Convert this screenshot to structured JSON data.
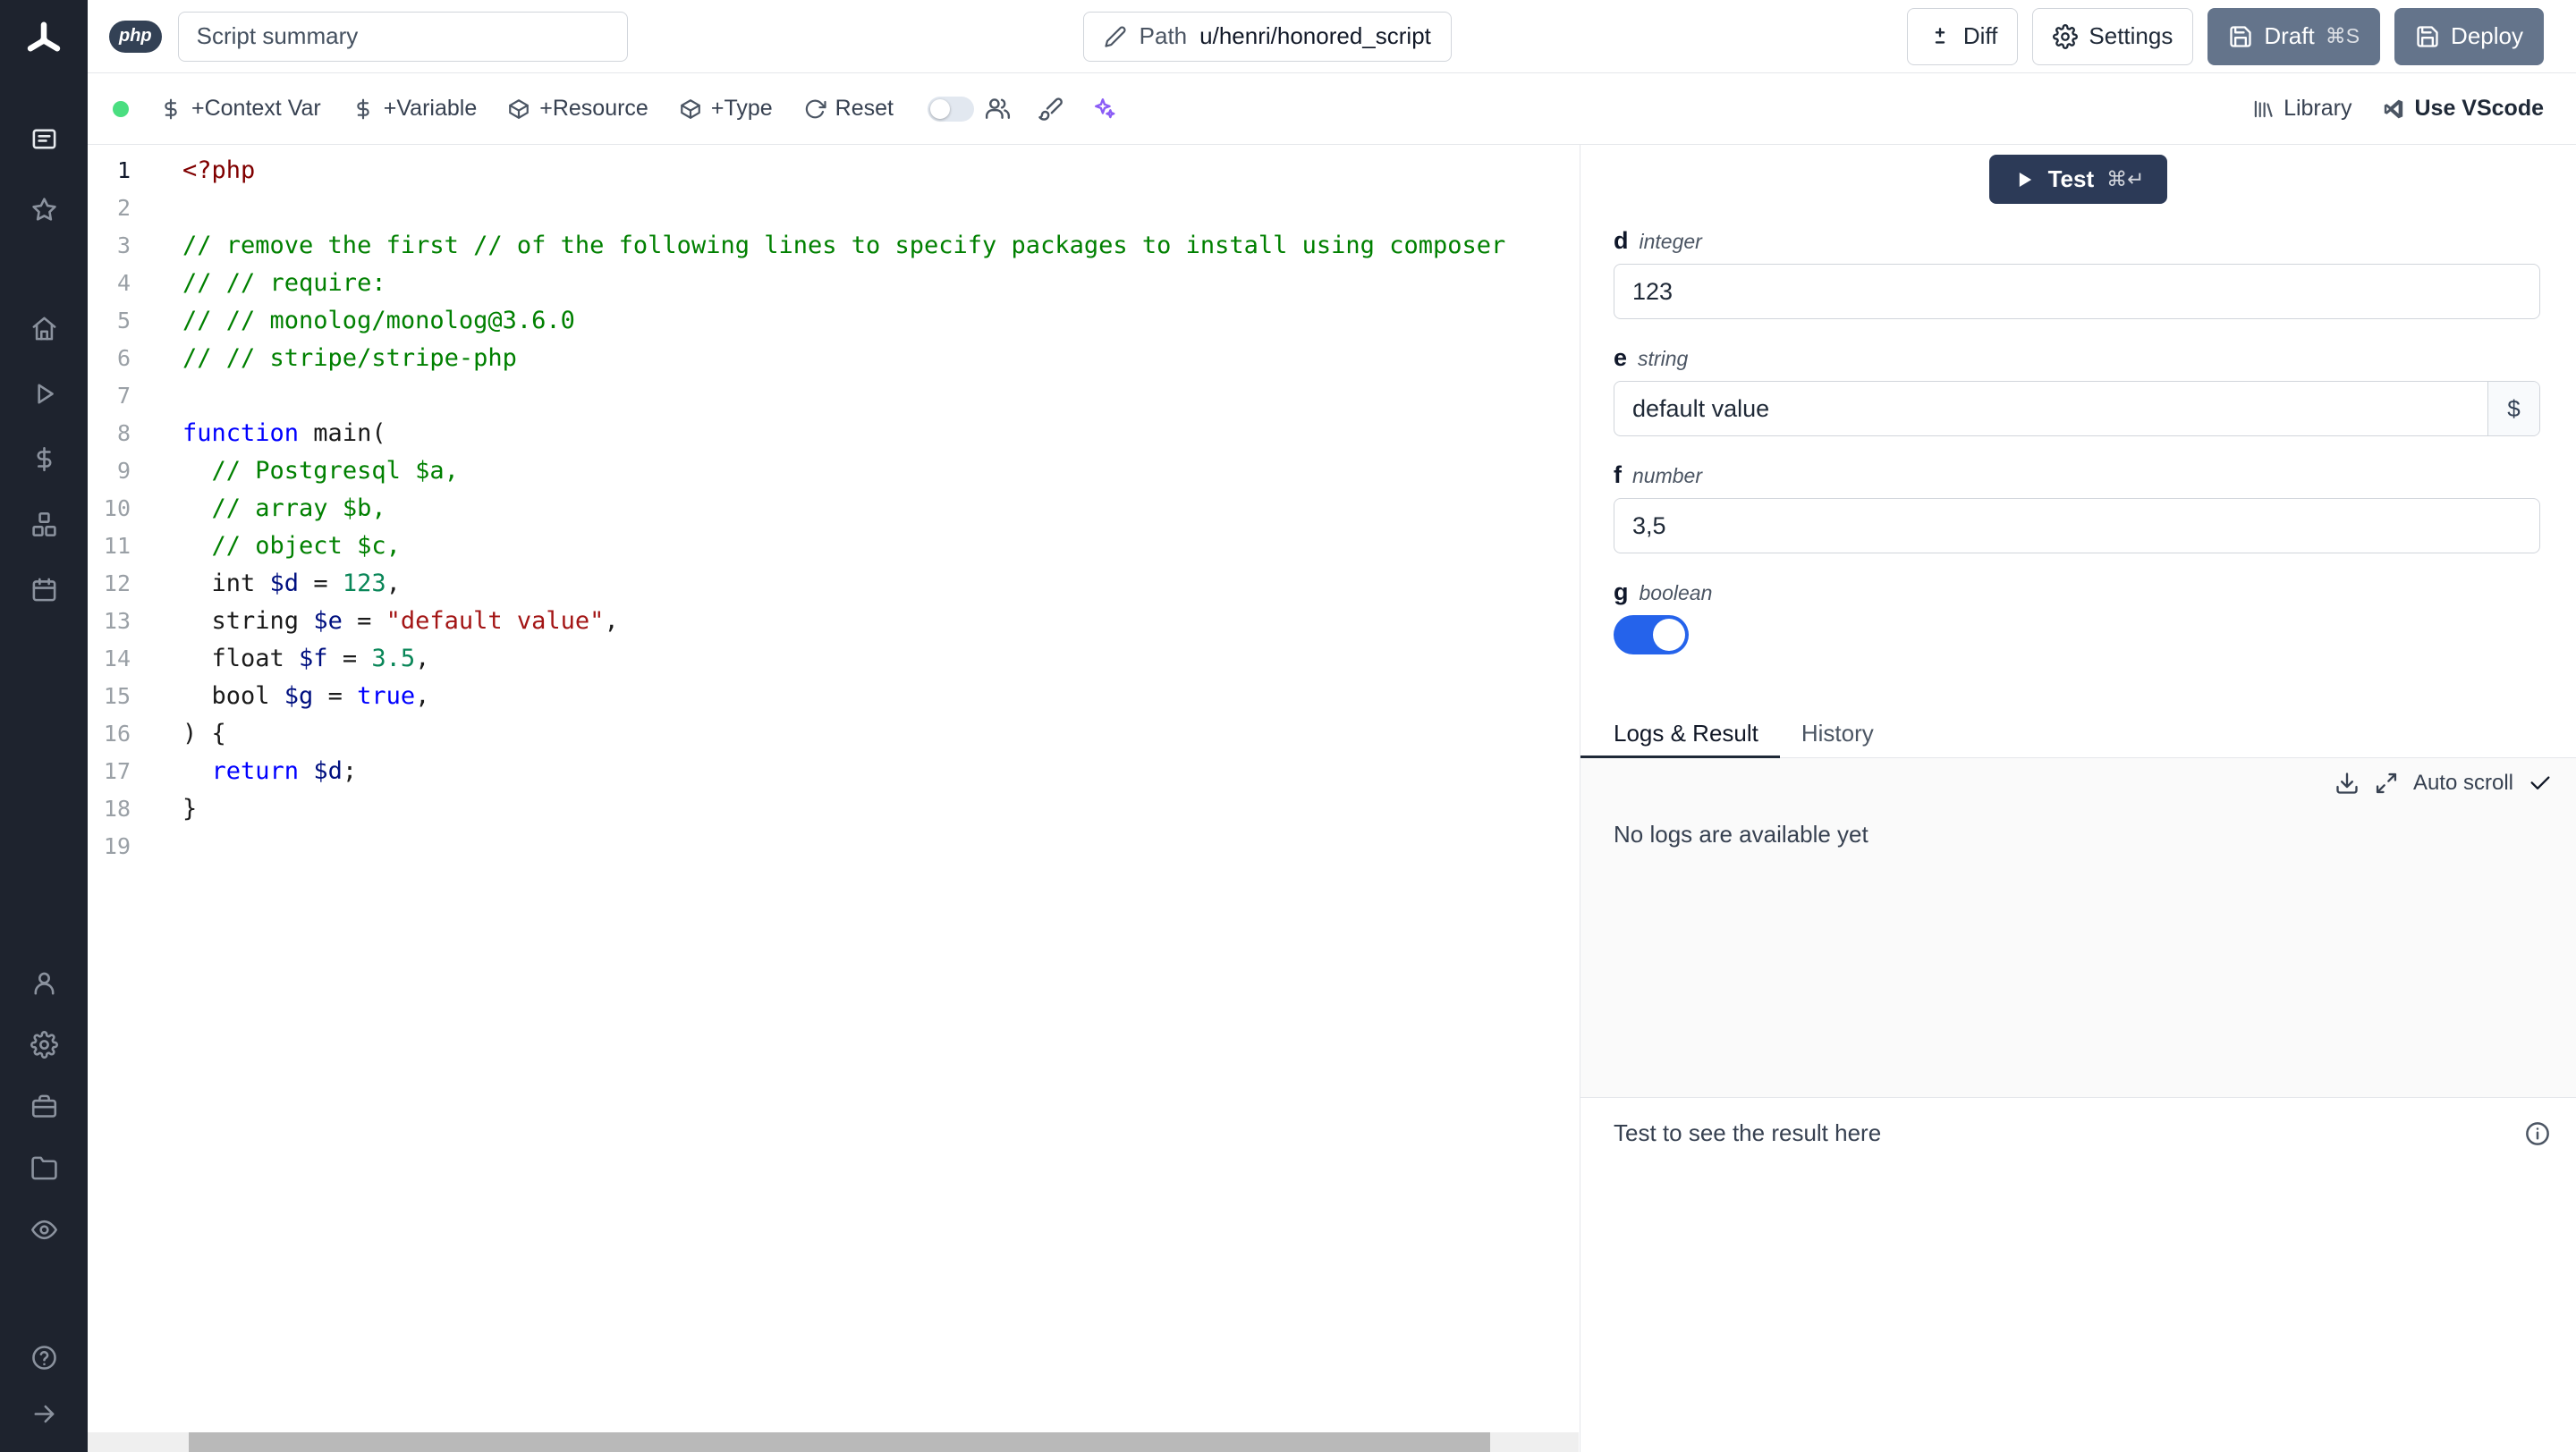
{
  "colors": {
    "accent_blue": "#2563eb",
    "sidebar_bg": "#1e232e",
    "slate_button_bg": "#64748b",
    "test_button_bg": "#2c3a57",
    "sparkle_purple": "#8b5cf6",
    "status_green": "#4ade80",
    "tab_active_underline": "#1f2937"
  },
  "topbar": {
    "language_badge": "php",
    "summary_placeholder": "Script summary",
    "path": {
      "label": "Path",
      "value": "u/henri/honored_script"
    },
    "buttons": {
      "diff": "Diff",
      "settings": "Settings",
      "draft": "Draft",
      "draft_shortcut": "⌘S",
      "deploy": "Deploy"
    }
  },
  "toolbar": {
    "left_items": [
      {
        "icon": "dollar-icon",
        "label": "+Context Var",
        "name": "add-context-var"
      },
      {
        "icon": "dollar-icon",
        "label": "+Variable",
        "name": "add-variable"
      },
      {
        "icon": "package-icon",
        "label": "+Resource",
        "name": "add-resource"
      },
      {
        "icon": "package-icon",
        "label": "+Type",
        "name": "add-type"
      },
      {
        "icon": "reset-icon",
        "label": "Reset",
        "name": "reset"
      }
    ],
    "library_label": "Library",
    "vscode_label": "Use VScode"
  },
  "sidebar": {
    "groups": [
      {
        "items": [
          {
            "icon": "panel-icon",
            "name": "quick-menu",
            "active": true
          },
          {
            "icon": "star-icon",
            "name": "favorites"
          }
        ]
      },
      {
        "items": [
          {
            "icon": "home-icon",
            "name": "home"
          },
          {
            "icon": "play-icon",
            "name": "runs"
          },
          {
            "icon": "dollar-icon",
            "name": "variables"
          },
          {
            "icon": "boxes-icon",
            "name": "resources"
          },
          {
            "icon": "calendar-icon",
            "name": "schedules"
          }
        ]
      },
      {
        "items": [
          {
            "icon": "user-icon",
            "name": "account"
          },
          {
            "icon": "gear-icon",
            "name": "settings"
          },
          {
            "icon": "toolbox-icon",
            "name": "workers"
          },
          {
            "icon": "folder-icon",
            "name": "folders"
          },
          {
            "icon": "eye-icon",
            "name": "audit-logs"
          }
        ]
      },
      {
        "items": [
          {
            "icon": "help-icon",
            "name": "help"
          },
          {
            "icon": "arrow-right-icon",
            "name": "expand-sidebar"
          }
        ]
      }
    ]
  },
  "editor": {
    "active_line": 1,
    "lines": [
      [
        {
          "t": "<?php",
          "c": "tag"
        }
      ],
      [],
      [
        {
          "t": "// remove the first // of the following lines to specify packages to install using composer",
          "c": "com"
        }
      ],
      [
        {
          "t": "// // require:",
          "c": "com"
        }
      ],
      [
        {
          "t": "// // monolog/monolog@3.6.0",
          "c": "com"
        }
      ],
      [
        {
          "t": "// // stripe/stripe-php",
          "c": "com"
        }
      ],
      [],
      [
        {
          "t": "function",
          "c": "kw"
        },
        {
          "t": " main(",
          "c": "pl"
        }
      ],
      [
        {
          "t": "  ",
          "c": "pl"
        },
        {
          "t": "// Postgresql $a,",
          "c": "com"
        }
      ],
      [
        {
          "t": "  ",
          "c": "pl"
        },
        {
          "t": "// array $b,",
          "c": "com"
        }
      ],
      [
        {
          "t": "  ",
          "c": "pl"
        },
        {
          "t": "// object $c,",
          "c": "com"
        }
      ],
      [
        {
          "t": "  int ",
          "c": "pl"
        },
        {
          "t": "$d",
          "c": "var"
        },
        {
          "t": " = ",
          "c": "pl"
        },
        {
          "t": "123",
          "c": "num"
        },
        {
          "t": ",",
          "c": "pl"
        }
      ],
      [
        {
          "t": "  string ",
          "c": "pl"
        },
        {
          "t": "$e",
          "c": "var"
        },
        {
          "t": " = ",
          "c": "pl"
        },
        {
          "t": "\"default value\"",
          "c": "str"
        },
        {
          "t": ",",
          "c": "pl"
        }
      ],
      [
        {
          "t": "  float ",
          "c": "pl"
        },
        {
          "t": "$f",
          "c": "var"
        },
        {
          "t": " = ",
          "c": "pl"
        },
        {
          "t": "3.5",
          "c": "num"
        },
        {
          "t": ",",
          "c": "pl"
        }
      ],
      [
        {
          "t": "  bool ",
          "c": "pl"
        },
        {
          "t": "$g",
          "c": "var"
        },
        {
          "t": " = ",
          "c": "pl"
        },
        {
          "t": "true",
          "c": "kw"
        },
        {
          "t": ",",
          "c": "pl"
        }
      ],
      [
        {
          "t": ") {",
          "c": "pl"
        }
      ],
      [
        {
          "t": "  ",
          "c": "pl"
        },
        {
          "t": "return",
          "c": "kw"
        },
        {
          "t": " ",
          "c": "pl"
        },
        {
          "t": "$d",
          "c": "var"
        },
        {
          "t": ";",
          "c": "pl"
        }
      ],
      [
        {
          "t": "}",
          "c": "pl"
        }
      ],
      []
    ]
  },
  "right_panel": {
    "test_button": {
      "label": "Test",
      "shortcut": "⌘↵"
    },
    "dollar_button": "$",
    "fields": [
      {
        "name": "d",
        "type": "integer",
        "value": "123",
        "kind": "input"
      },
      {
        "name": "e",
        "type": "string",
        "value": "default value",
        "kind": "input-dollar"
      },
      {
        "name": "f",
        "type": "number",
        "value": "3,5",
        "kind": "input"
      },
      {
        "name": "g",
        "type": "boolean",
        "value": true,
        "kind": "toggle"
      }
    ],
    "tabs": [
      {
        "label": "Logs & Result",
        "active": true
      },
      {
        "label": "History",
        "active": false
      }
    ],
    "logs": {
      "auto_scroll_label": "Auto scroll",
      "empty_message": "No logs are available yet"
    },
    "result_placeholder": "Test to see the result here"
  }
}
